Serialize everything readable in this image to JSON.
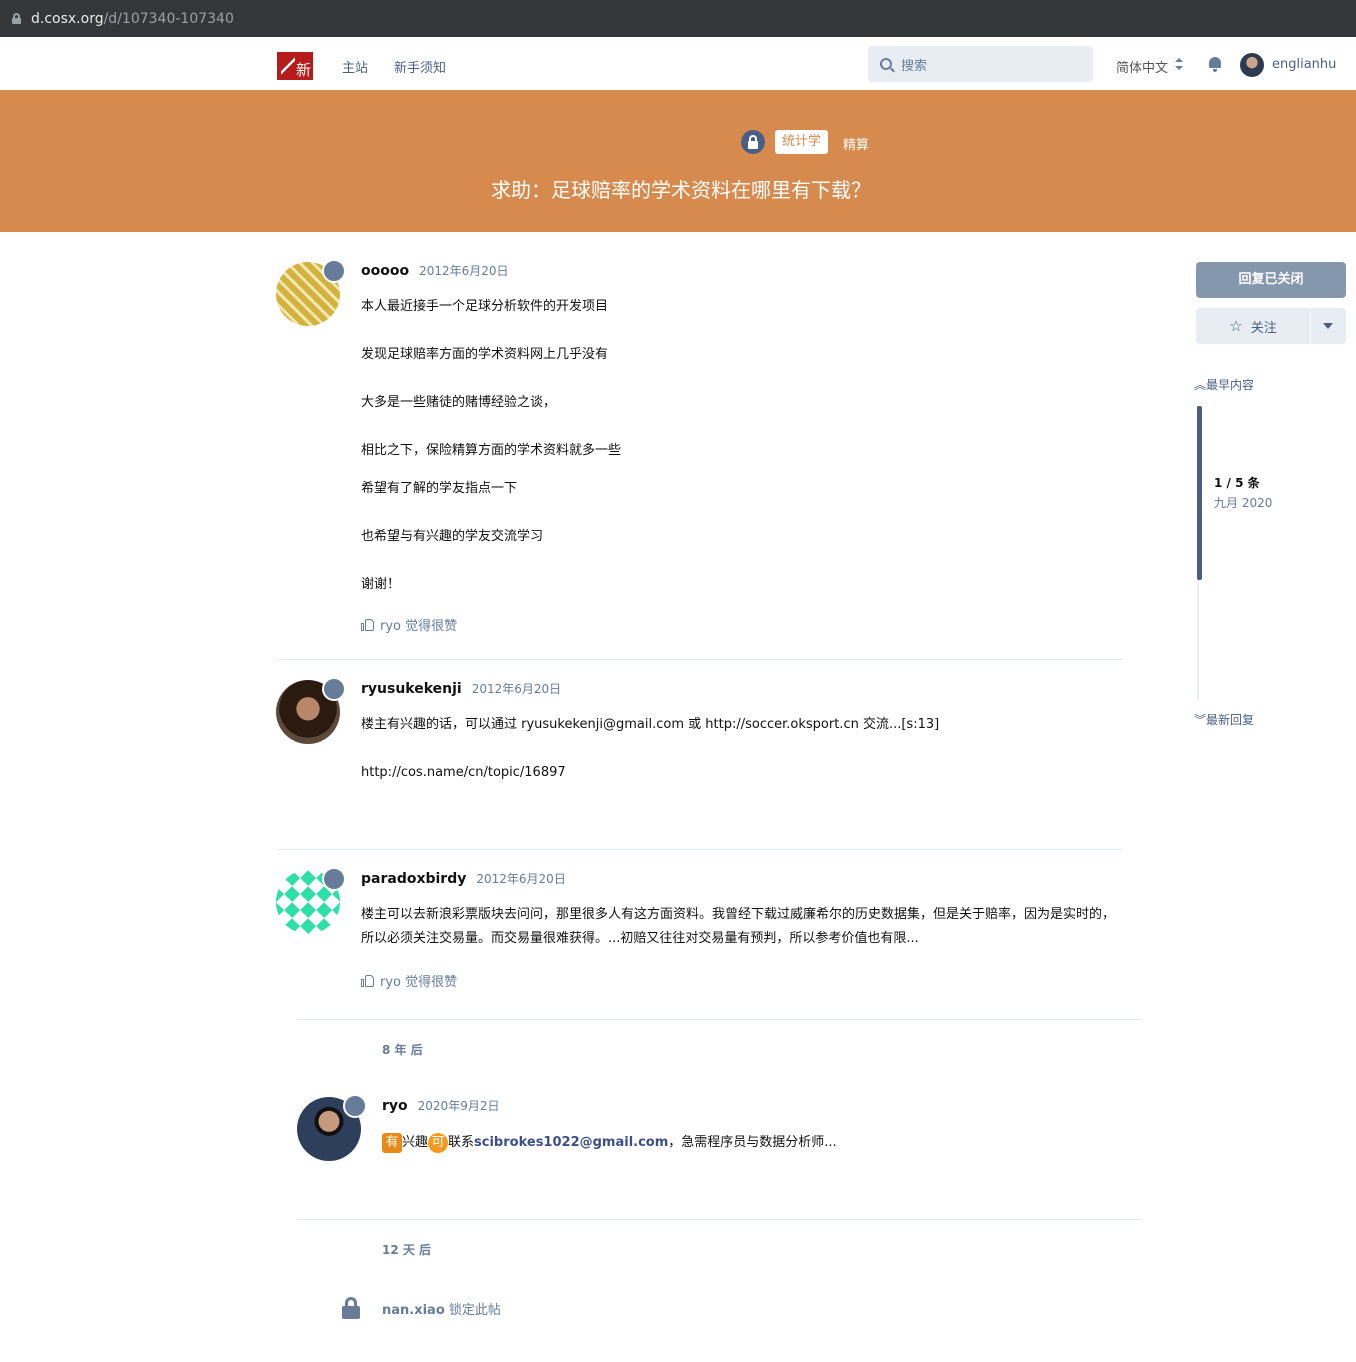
{
  "browser": {
    "host": "d.cosx.org",
    "path": "/d/107340-107340"
  },
  "header": {
    "nav": [
      "主站",
      "新手须知"
    ],
    "search_placeholder": "搜索",
    "language": "简体中文",
    "user": "englianhu"
  },
  "discussion": {
    "tags": {
      "primary": "统计学",
      "secondary": "精算"
    },
    "title": "求助：足球赔率的学术资料在哪里有下载？"
  },
  "posts": [
    {
      "user": "ooooo",
      "date": "2012年6月20日",
      "paragraphs": [
        "本人最近接手一个足球分析软件的开发项目",
        "发现足球赔率方面的学术资料网上几乎没有",
        "大多是一些赌徒的赌博经验之谈，",
        "相比之下，保险精算方面的学术资料就多一些",
        "希望有了解的学友指点一下",
        "也希望与有兴趣的学友交流学习",
        "谢谢！"
      ],
      "likes": "ryo 觉得很赞"
    },
    {
      "user": "ryusukekenji",
      "date": "2012年6月20日",
      "paragraphs": [
        "楼主有兴趣的话，可以通过 ryusukekenji@gmail.com 或 http://soccer.oksport.cn 交流...[s:13]",
        "http://cos.name/cn/topic/16897"
      ]
    },
    {
      "user": "paradoxbirdy",
      "date": "2012年6月20日",
      "paragraphs": [
        "楼主可以去新浪彩票版块去问问，那里很多人有这方面资料。我曾经下载过威廉希尔的历史数据集，但是关于赔率，因为是实时的，所以必须关注交易量。而交易量很难获得。...初赔又往往对交易量有预判，所以参考价值也有限..."
      ],
      "likes": "ryo 觉得很赞"
    },
    {
      "user": "ryo",
      "date": "2020年9月2日",
      "chip1": "有",
      "text1": "兴趣",
      "chip2": "可",
      "text2": "联系",
      "email": "scibrokes1022@gmail.com",
      "text3": "，急需程序员与数据分析师..."
    }
  ],
  "gaps": [
    "8 年 后",
    "12 天 后"
  ],
  "event": {
    "user": "nan.xiao",
    "action": "锁定此帖"
  },
  "sidebar": {
    "reply_closed": "回复已关闭",
    "follow": "关注",
    "earliest": "最早内容",
    "latest": "最新回复",
    "count": "1 / 5 条",
    "date": "九月 2020"
  },
  "colors": {
    "hero": "#d68a4d",
    "accent": "#4b5f86"
  }
}
